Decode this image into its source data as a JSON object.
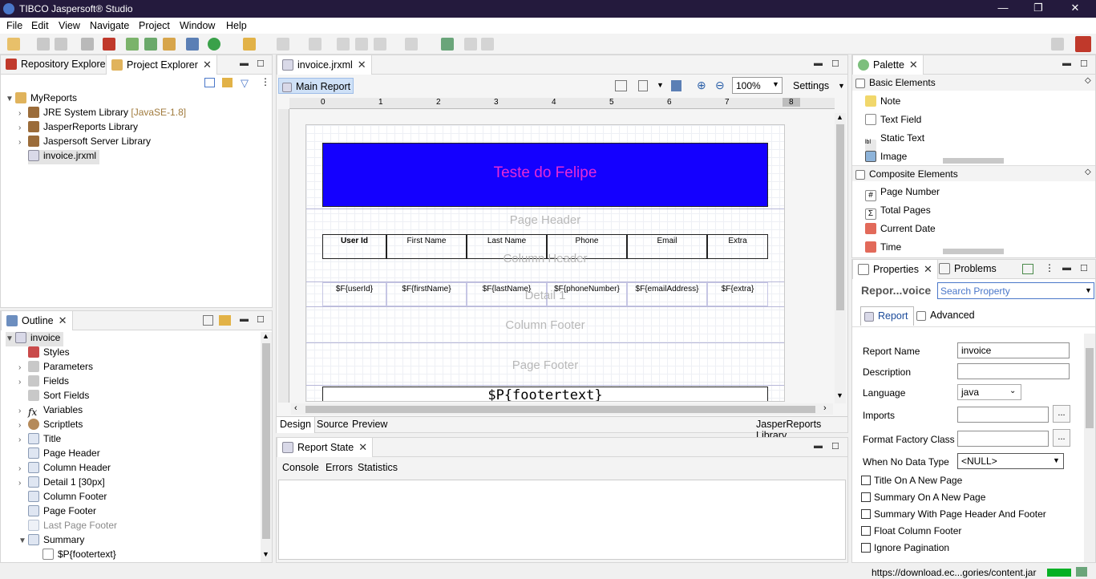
{
  "window": {
    "title": "TIBCO Jaspersoft® Studio",
    "min": "—",
    "restore": "❐",
    "close": "✕"
  },
  "menu": [
    "File",
    "Edit",
    "View",
    "Navigate",
    "Project",
    "Window",
    "Help"
  ],
  "left_top": {
    "tabs": [
      {
        "label": "Repository Explorer"
      },
      {
        "label": "Project Explorer"
      }
    ],
    "tree": [
      {
        "label": "MyReports",
        "extra": ""
      },
      {
        "label": "JRE System Library",
        "extra": "[JavaSE-1.8]"
      },
      {
        "label": "JasperReports Library",
        "extra": ""
      },
      {
        "label": "Jaspersoft Server Library",
        "extra": ""
      },
      {
        "label": "invoice.jrxml",
        "extra": ""
      }
    ]
  },
  "outline": {
    "tab": "Outline",
    "root": "invoice",
    "items": [
      "Styles",
      "Parameters",
      "Fields",
      "Sort Fields",
      "Variables",
      "Scriptlets",
      "Title",
      "Page Header",
      "Column Header",
      "Detail 1 [30px]",
      "Column Footer",
      "Page Footer",
      "Last Page Footer",
      "Summary",
      "$P{footertext}"
    ]
  },
  "editor": {
    "tab": "invoice.jrxml",
    "main_report": "Main Report",
    "zoom": "100%",
    "settings": "Settings",
    "ruler": [
      "0",
      "1",
      "2",
      "3",
      "4",
      "5",
      "6",
      "7",
      "8"
    ],
    "title_text": "Teste do Felipe",
    "title_color": "#1400ff",
    "title_text_color": "#e52ad6",
    "bands": {
      "page_header": "Page Header",
      "column_header": "Column Header",
      "detail": "Detail 1",
      "column_footer": "Column Footer",
      "page_footer": "Page Footer"
    },
    "columns": [
      "User Id",
      "First Name",
      "Last Name",
      "Phone",
      "Email",
      "Extra"
    ],
    "fields": [
      "$F{userId}",
      "$F{firstName}",
      "$F{lastName}",
      "$F{phoneNumber}",
      "$F{emailAddress}",
      "$F{extra}"
    ],
    "footer_text": "$P{footertext}",
    "bottom_tabs": [
      "Design",
      "Source",
      "Preview"
    ],
    "library": "JasperReports Library"
  },
  "report_state": {
    "tab": "Report State",
    "subtabs": [
      "Console",
      "Errors",
      "Statistics"
    ]
  },
  "palette": {
    "tab": "Palette",
    "basic": {
      "header": "Basic Elements",
      "items": [
        "Note",
        "Text Field",
        "Static Text",
        "Image"
      ]
    },
    "composite": {
      "header": "Composite Elements",
      "items": [
        "Page Number",
        "Total Pages",
        "Current Date",
        "Time"
      ]
    }
  },
  "properties": {
    "tabs": [
      "Properties",
      "Problems"
    ],
    "title": "Repor...voice",
    "search_placeholder": "Search Property",
    "subtabs": [
      "Report",
      "Advanced"
    ],
    "fields": {
      "report_name_label": "Report Name",
      "report_name": "invoice",
      "description_label": "Description",
      "language_label": "Language",
      "language": "java",
      "imports_label": "Imports",
      "format_factory_label": "Format Factory Class",
      "when_no_data_label": "When No Data Type",
      "when_no_data": "<NULL>"
    },
    "checkboxes": [
      "Title On A New Page",
      "Summary On A New Page",
      "Summary With Page Header And Footer",
      "Float Column Footer",
      "Ignore Pagination"
    ]
  },
  "status": {
    "text": "https://download.ec...gories/content.jar"
  }
}
